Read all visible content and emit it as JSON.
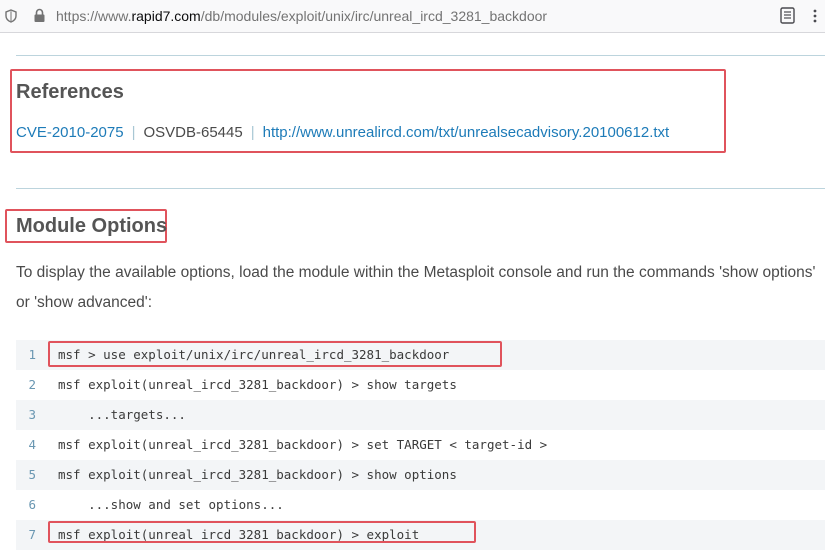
{
  "browser": {
    "url_scheme": "https://www.",
    "url_host": "rapid7.com",
    "url_path": "/db/modules/exploit/unix/irc/unreal_ircd_3281_backdoor",
    "icons": [
      "shield-icon",
      "lock-icon",
      "reader-view-icon",
      "menu-icon"
    ]
  },
  "references": {
    "heading": "References",
    "items": [
      {
        "label": "CVE-2010-2075",
        "link": true
      },
      {
        "label": "OSVDB-65445",
        "link": false
      },
      {
        "label": "http://www.unrealircd.com/txt/unrealsecadvisory.20100612.txt",
        "link": true
      }
    ],
    "separator": "|"
  },
  "module_options": {
    "heading": "Module Options",
    "description": "To display the available options, load the module within the Metasploit console and run the commands 'show options' or 'show advanced':"
  },
  "code": {
    "lines": [
      {
        "num": "1",
        "text": "msf > use exploit/unix/irc/unreal_ircd_3281_backdoor"
      },
      {
        "num": "2",
        "text": "msf exploit(unreal_ircd_3281_backdoor) > show targets"
      },
      {
        "num": "3",
        "text": "    ...targets..."
      },
      {
        "num": "4",
        "text": "msf exploit(unreal_ircd_3281_backdoor) > set TARGET < target-id >"
      },
      {
        "num": "5",
        "text": "msf exploit(unreal_ircd_3281_backdoor) > show options"
      },
      {
        "num": "6",
        "text": "    ...show and set options..."
      },
      {
        "num": "7",
        "text": "msf exploit(unreal_ircd_3281_backdoor) > exploit"
      }
    ]
  },
  "colors": {
    "highlight_box": "#e0535c",
    "link": "#1d7bb8",
    "line_number": "#6a97b2"
  }
}
